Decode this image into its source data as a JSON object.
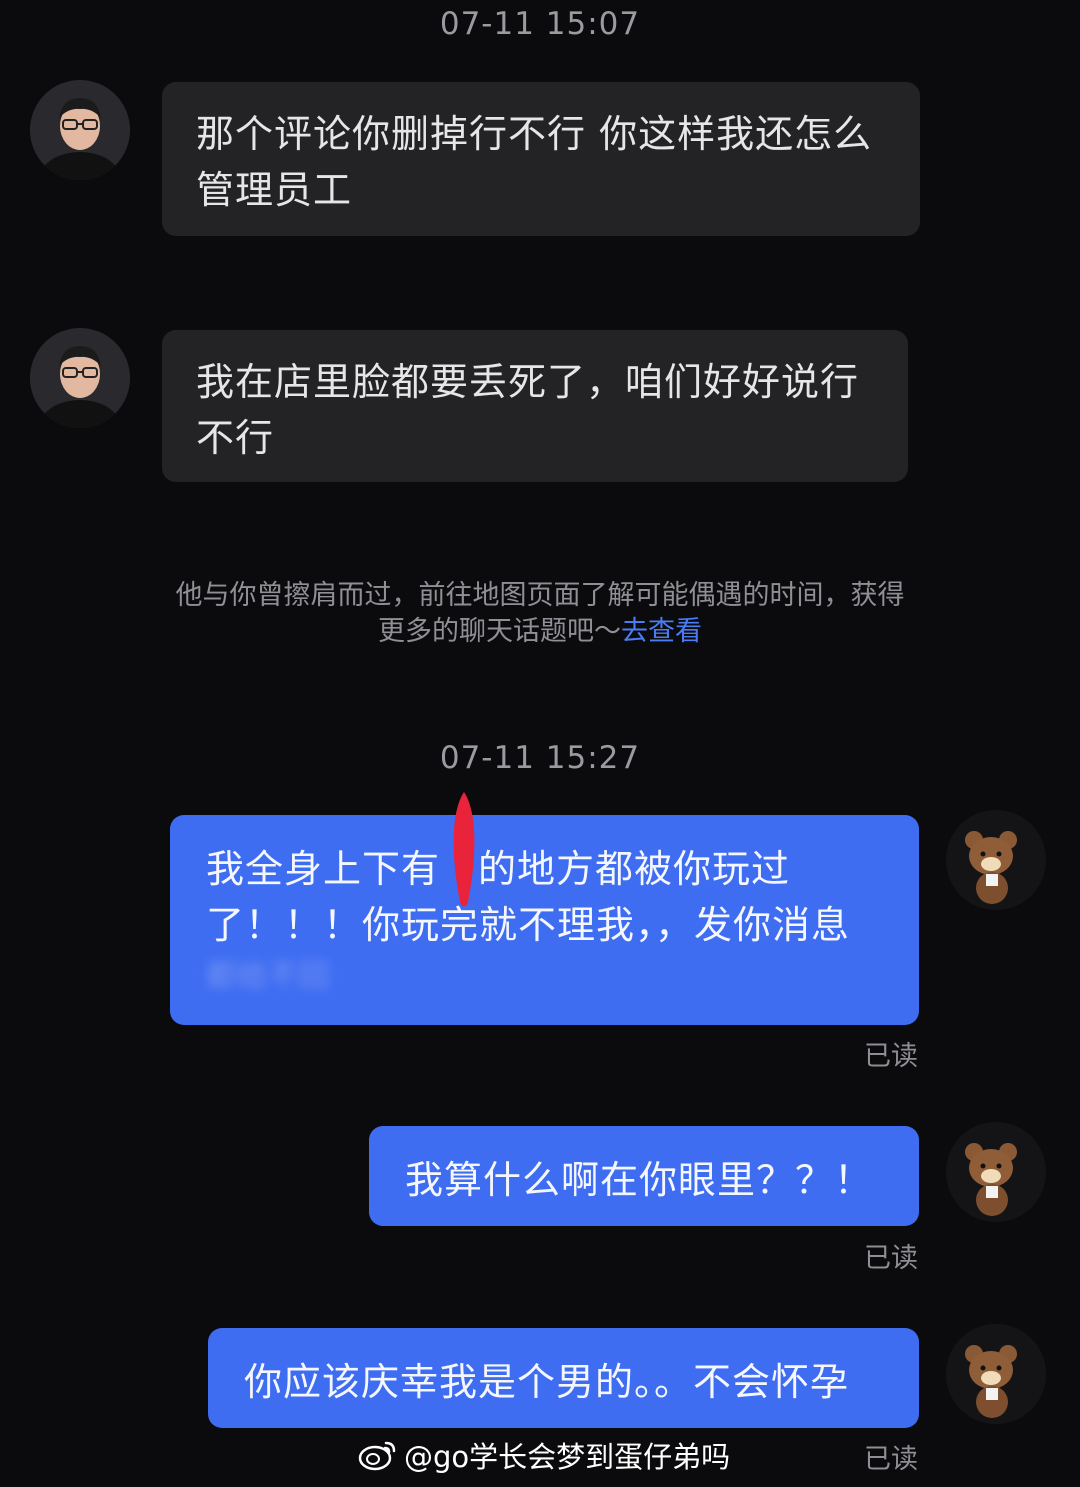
{
  "timestamps": {
    "first": "07-11 15:07",
    "second": "07-11 15:27"
  },
  "incoming": [
    {
      "line1": "那个评论你删掉行不行 你这样我还怎么",
      "line2": "管理员工"
    },
    {
      "line1": "我在店里脸都要丢死了，咱们好好说行",
      "line2": "不行"
    }
  ],
  "system_tip": {
    "line1": "他与你曾擦肩而过，前往地图页面了解可能偶遇的时间，获得",
    "line2_prefix": "更多的聊天话题吧～",
    "link": "去查看"
  },
  "outgoing": [
    {
      "line1_a": "我全身上下有",
      "line1_b": "的地方都被你玩过",
      "line2": "了！！！你玩完就不理我，，发你消息",
      "line3": "都给不回"
    },
    {
      "text": "我算什么啊在你眼里？？！"
    },
    {
      "text": "你应该庆幸我是个男的。。不会怀孕"
    }
  ],
  "read_status": "已读",
  "watermark": {
    "text": "@go学长会梦到蛋仔弟吗"
  },
  "colors": {
    "background": "#0b0b0d",
    "incoming_bubble": "#232326",
    "outgoing_bubble": "#3f6df2",
    "link": "#4a7cf6"
  }
}
